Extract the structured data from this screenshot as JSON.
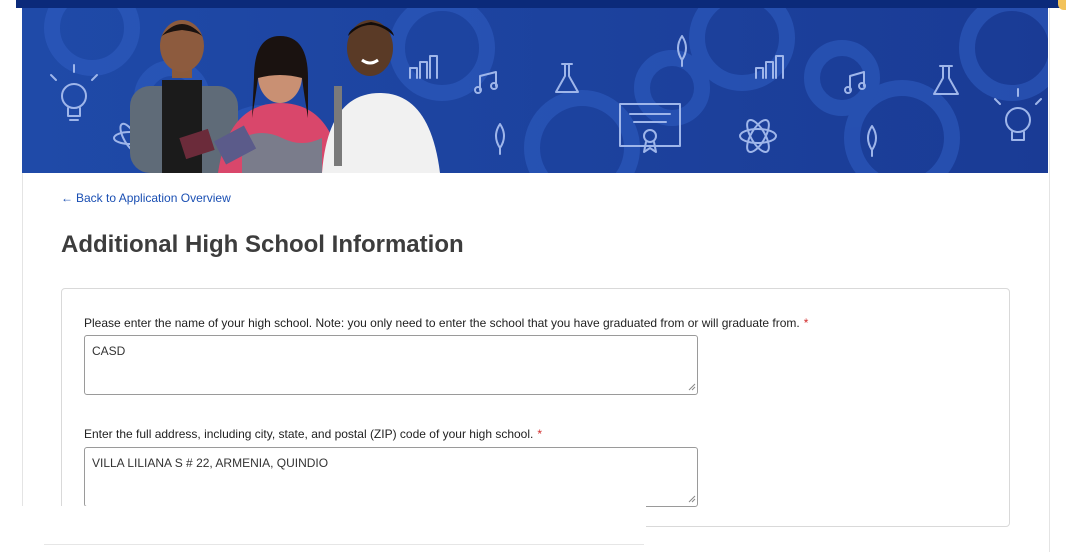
{
  "nav": {
    "back_label": "Back to Application Overview",
    "back_arrow": "←"
  },
  "page": {
    "title": "Additional High School Information"
  },
  "form": {
    "q1": {
      "label": "Please enter the name of your high school. Note: you only need to enter the school that you have graduated from or will graduate from.",
      "required_mark": "*",
      "value": "CASD"
    },
    "q2": {
      "label": "Enter the full address, including city, state, and postal (ZIP) code of your high school.",
      "required_mark": "*",
      "value": "VILLA LILIANA S # 22, ARMENIA, QUINDIO"
    }
  },
  "banner": {
    "icons": [
      "lightbulb-icon",
      "atom-icon",
      "bar-chart-icon",
      "music-note-icon",
      "flask-icon",
      "leaf-icon",
      "certificate-icon",
      "bar-chart-icon",
      "atom-icon",
      "music-note-icon",
      "leaf-icon",
      "flask-icon",
      "lightbulb-icon"
    ],
    "photo": "three-students-photo"
  },
  "colors": {
    "accent": "#1a4fb3",
    "banner_bg": "#1a3f9c",
    "top_bar": "#0b2a7a",
    "required": "#d12c2c"
  }
}
